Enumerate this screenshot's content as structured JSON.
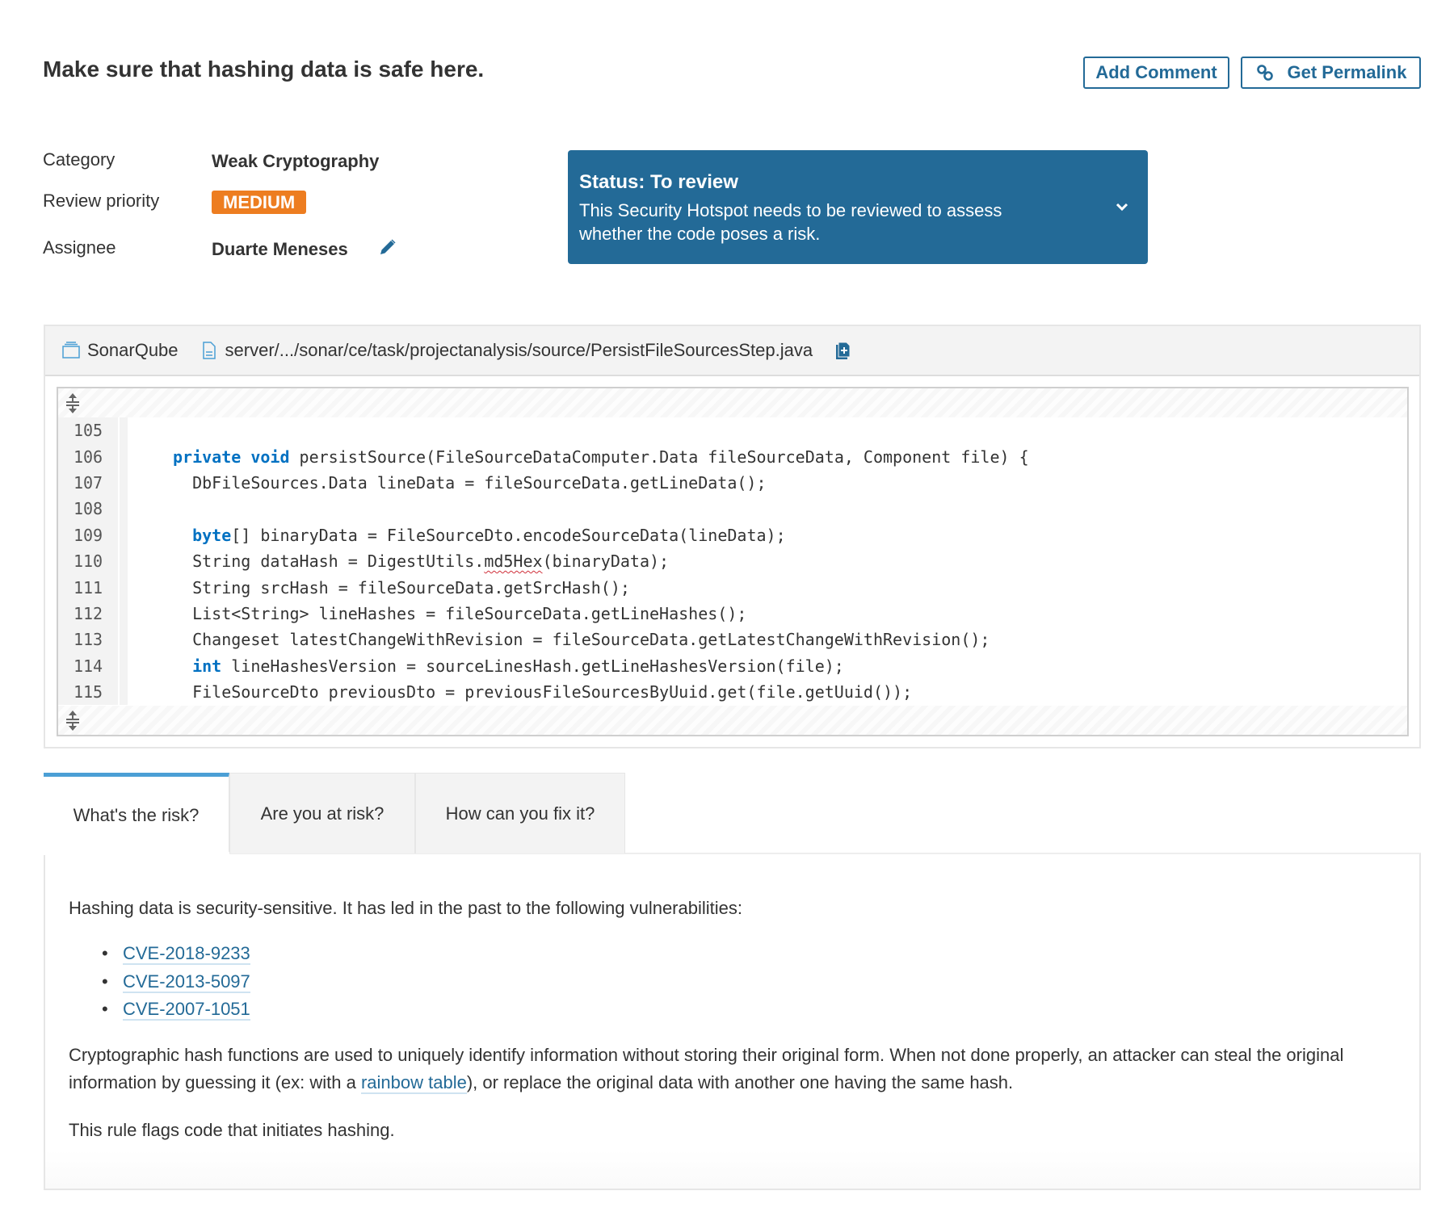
{
  "header": {
    "title": "Make sure that hashing data is safe here.",
    "add_comment_label": "Add Comment",
    "get_permalink_label": "Get Permalink"
  },
  "meta": {
    "category_label": "Category",
    "category_value": "Weak Cryptography",
    "priority_label": "Review priority",
    "priority_value": "MEDIUM",
    "priority_color": "#ed7d20",
    "assignee_label": "Assignee",
    "assignee_value": "Duarte Meneses"
  },
  "status": {
    "title": "Status: To review",
    "description": "This Security Hotspot needs to be reviewed to assess whether the code poses a risk.",
    "color": "#236a97"
  },
  "file": {
    "project": "SonarQube",
    "path": "server/.../sonar/ce/task/projectanalysis/source/PersistFileSourcesStep.java"
  },
  "code": {
    "lines": [
      {
        "num": "105",
        "text": ""
      },
      {
        "num": "106",
        "text": "private void persistSource(FileSourceDataComputer.Data fileSourceData, Component file) {"
      },
      {
        "num": "107",
        "text": "  DbFileSources.Data lineData = fileSourceData.getLineData();"
      },
      {
        "num": "108",
        "text": ""
      },
      {
        "num": "109",
        "text": "  byte[] binaryData = FileSourceDto.encodeSourceData(lineData);"
      },
      {
        "num": "110",
        "text": "  String dataHash = DigestUtils.md5Hex(binaryData);"
      },
      {
        "num": "111",
        "text": "  String srcHash = fileSourceData.getSrcHash();"
      },
      {
        "num": "112",
        "text": "  List<String> lineHashes = fileSourceData.getLineHashes();"
      },
      {
        "num": "113",
        "text": "  Changeset latestChangeWithRevision = fileSourceData.getLatestChangeWithRevision();"
      },
      {
        "num": "114",
        "text": "  int lineHashesVersion = sourceLinesHash.getLineHashesVersion(file);"
      },
      {
        "num": "115",
        "text": "  FileSourceDto previousDto = previousFileSourcesByUuid.get(file.getUuid());"
      }
    ],
    "keywords": [
      "private",
      "void",
      "byte",
      "int"
    ],
    "highlight_token": "md5Hex",
    "highlight_line": "110"
  },
  "tabs": [
    {
      "label": "What's the risk?",
      "active": true
    },
    {
      "label": "Are you at risk?",
      "active": false
    },
    {
      "label": "How can you fix it?",
      "active": false
    }
  ],
  "risk": {
    "intro": "Hashing data is security-sensitive. It has led in the past to the following vulnerabilities:",
    "cves": [
      "CVE-2018-9233",
      "CVE-2013-5097",
      "CVE-2007-1051"
    ],
    "para2_before": "Cryptographic hash functions are used to uniquely identify information without storing their original form. When not done properly, an attacker can steal the original information by guessing it (ex: with a ",
    "para2_link": "rainbow table",
    "para2_after": "), or replace the original data with another one having the same hash.",
    "para3": "This rule flags code that initiates hashing."
  }
}
